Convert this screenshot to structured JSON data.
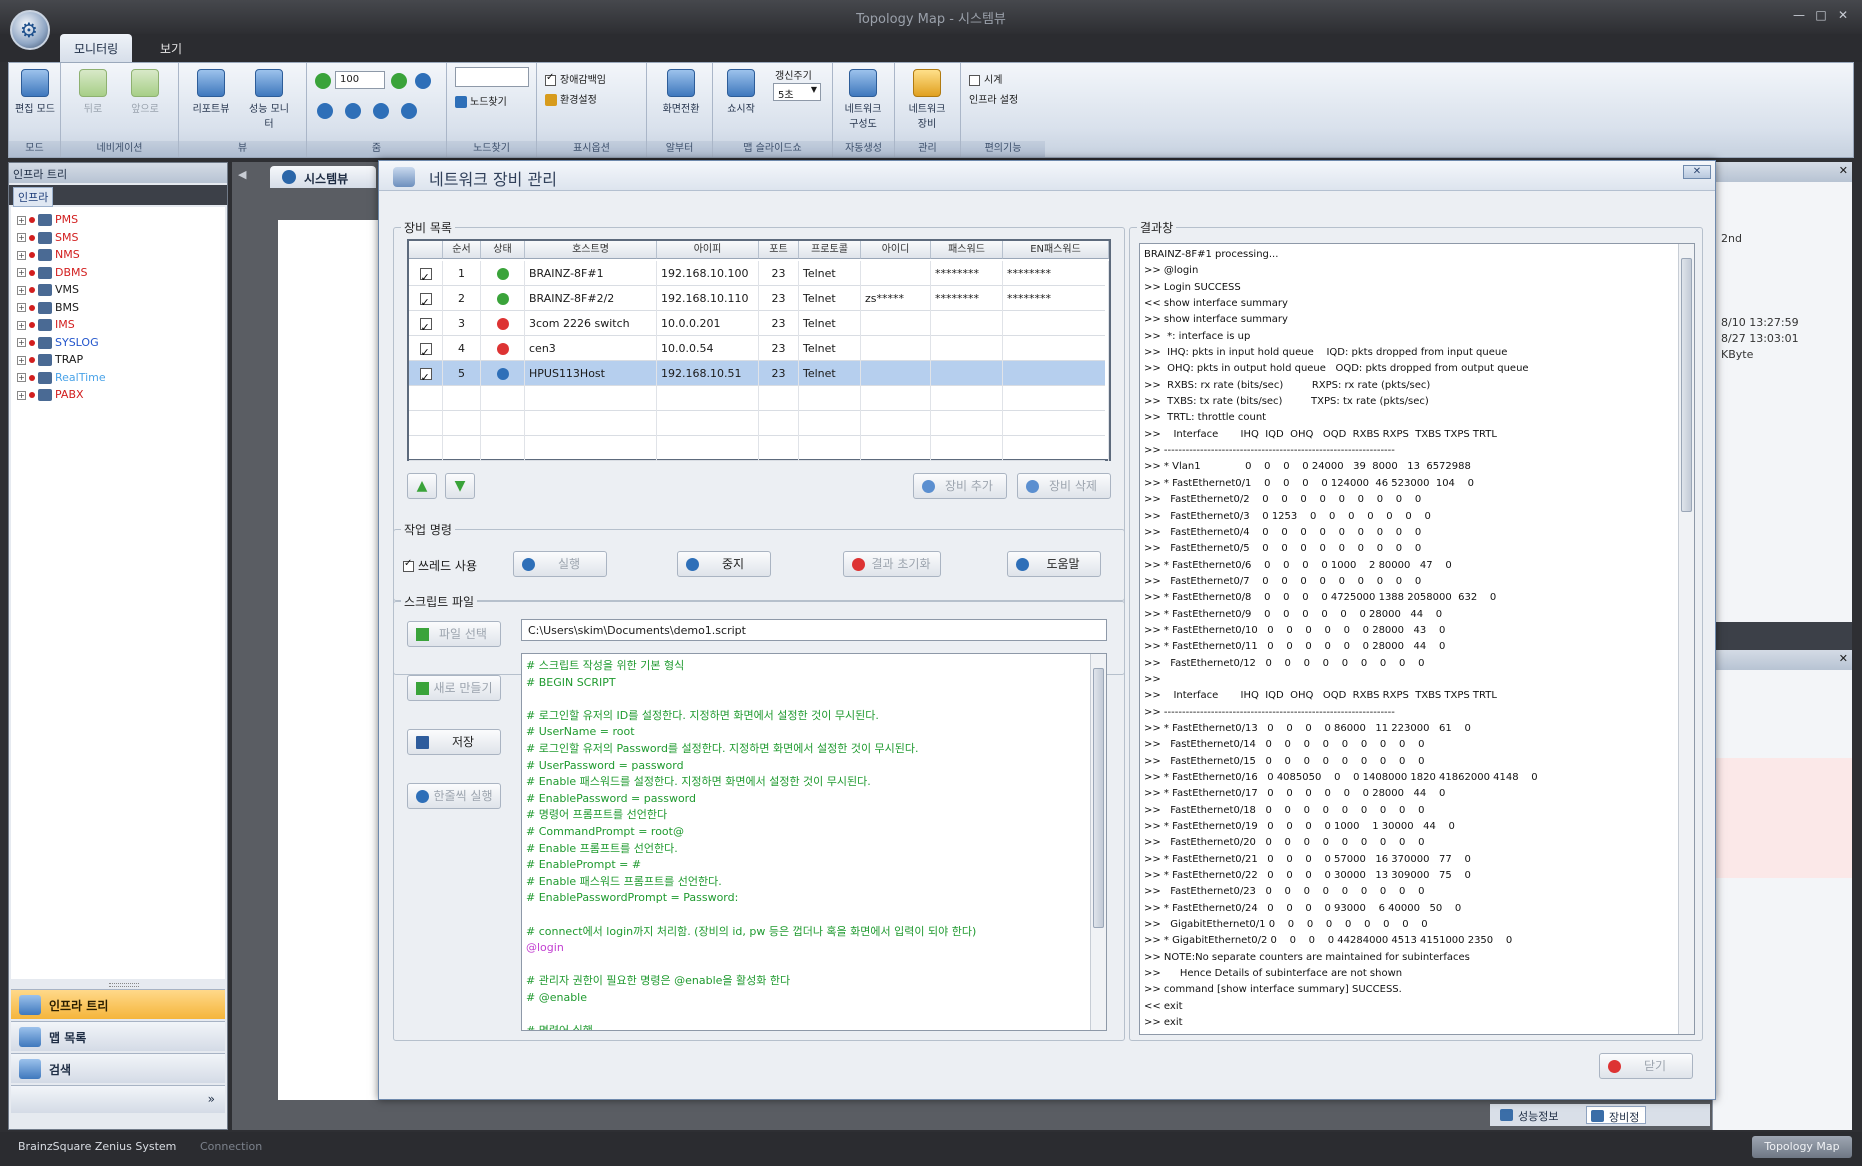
{
  "window": {
    "title": "Topology Map - 시스템뷰"
  },
  "ribbon": {
    "tabs": [
      "모니터링",
      "보기"
    ],
    "groups": [
      {
        "label": "모드",
        "buttons": [
          "편집 모드"
        ]
      },
      {
        "label": "네비게이션",
        "buttons": [
          "뒤로",
          "앞으로"
        ]
      },
      {
        "label": "뷰",
        "buttons": [
          "리포트뷰",
          "성능 모니터"
        ]
      },
      {
        "label": "줌",
        "zoom_value": "100"
      },
      {
        "label": "노드찾기",
        "buttons": [
          "노드찾기"
        ]
      },
      {
        "label": "표시옵션",
        "checkbox": "장애감백임",
        "button": "환경설정"
      },
      {
        "label": "알부터",
        "buttons": [
          "화면전환"
        ]
      },
      {
        "label": "맵 슬라이드쇼",
        "buttons": [
          "쇼시작"
        ],
        "cycle_label": "갱신주기",
        "cycle_value": "5초"
      },
      {
        "label": "자동생성",
        "buttons": [
          "네트워크 구성도"
        ]
      },
      {
        "label": "관리",
        "buttons": [
          "네트워크 장비"
        ]
      },
      {
        "label": "편의기능",
        "checkbox": "시계",
        "button": "인프라 설정"
      }
    ]
  },
  "left_panel": {
    "title": "인프라 트리",
    "root": "인프라",
    "tree": [
      {
        "label": "PMS",
        "color": "#d21e1e"
      },
      {
        "label": "SMS",
        "color": "#d21e1e"
      },
      {
        "label": "NMS",
        "color": "#d21e1e"
      },
      {
        "label": "DBMS",
        "color": "#d21e1e"
      },
      {
        "label": "VMS",
        "color": "#1a1a1a"
      },
      {
        "label": "BMS",
        "color": "#1a1a1a"
      },
      {
        "label": "IMS",
        "color": "#d21e1e"
      },
      {
        "label": "SYSLOG",
        "color": "#2255cc"
      },
      {
        "label": "TRAP",
        "color": "#1a1a1a"
      },
      {
        "label": "RealTime",
        "color": "#4aa3e8"
      },
      {
        "label": "PABX",
        "color": "#d21e1e"
      }
    ],
    "nav": [
      "인프라 트리",
      "맵 목록",
      "검색"
    ]
  },
  "doc_tab": "시스템뷰",
  "dialog": {
    "title": "네트워크 장비 관리",
    "device_list": {
      "label": "장비 목록",
      "headers": [
        "순서",
        "상태",
        "호스트명",
        "아이피",
        "포트",
        "프로토콜",
        "아이디",
        "패스워드",
        "EN패스워드"
      ],
      "rows": [
        {
          "order": "1",
          "status": "ok",
          "host": "BRAINZ-8F#1",
          "ip": "192.168.10.100",
          "port": "23",
          "protocol": "Telnet",
          "id": "",
          "password": "********",
          "en_password": "********"
        },
        {
          "order": "2",
          "status": "ok",
          "host": "BRAINZ-8F#2/2",
          "ip": "192.168.10.110",
          "port": "23",
          "protocol": "Telnet",
          "id": "zs*****",
          "password": "********",
          "en_password": "********"
        },
        {
          "order": "3",
          "status": "err",
          "host": "3com 2226 switch",
          "ip": "10.0.0.201",
          "port": "23",
          "protocol": "Telnet",
          "id": "",
          "password": "",
          "en_password": ""
        },
        {
          "order": "4",
          "status": "err",
          "host": "cen3",
          "ip": "10.0.0.54",
          "port": "23",
          "protocol": "Telnet",
          "id": "",
          "password": "",
          "en_password": ""
        },
        {
          "order": "5",
          "status": "host",
          "host": "HPUS113Host",
          "ip": "192.168.10.51",
          "port": "23",
          "protocol": "Telnet",
          "id": "",
          "password": "",
          "en_password": ""
        }
      ],
      "add_button": "장비 추가",
      "delete_button": "장비 삭제"
    },
    "job": {
      "label": "작업 명령",
      "thread_checkbox": "쓰레드 사용",
      "run_button": "실행",
      "stop_button": "중지",
      "clear_button": "결과 초기화",
      "help_button": "도움말"
    },
    "script": {
      "label": "스크립트 파일",
      "select_button": "파일 선택",
      "new_button": "새로 만들기",
      "save_button": "저장",
      "run_once_button": "한줄씩 실행",
      "path": "C:\\Users\\skim\\Documents\\demo1.script",
      "lines": [
        {
          "t": "# 스크립트 작성을 위한 기본 형식",
          "c": "#1f9a2f"
        },
        {
          "t": "# BEGIN SCRIPT",
          "c": "#1f9a2f"
        },
        {
          "t": "",
          "c": "#1f9a2f"
        },
        {
          "t": "# 로그인할 유저의 ID를 설정한다. 지정하면 화면에서 설정한 것이 무시된다.",
          "c": "#1f9a2f"
        },
        {
          "t": "# UserName = root",
          "c": "#1f9a2f"
        },
        {
          "t": "# 로그인할 유저의 Password를 설정한다. 지정하면 화면에서 설정한 것이 무시된다.",
          "c": "#1f9a2f"
        },
        {
          "t": "# UserPassword = password",
          "c": "#1f9a2f"
        },
        {
          "t": "# Enable 패스워드를 설정한다. 지정하면 화면에서 설정한 것이 무시된다.",
          "c": "#1f9a2f"
        },
        {
          "t": "# EnablePassword = password",
          "c": "#1f9a2f"
        },
        {
          "t": "# 명령어 프롬프트를 선언한다",
          "c": "#1f9a2f"
        },
        {
          "t": "# CommandPrompt = root@",
          "c": "#1f9a2f"
        },
        {
          "t": "# Enable 프롬프트를 선언한다.",
          "c": "#1f9a2f"
        },
        {
          "t": "# EnablePrompt = #",
          "c": "#1f9a2f"
        },
        {
          "t": "# Enable 패스워드 프롬프트를 선언한다.",
          "c": "#1f9a2f"
        },
        {
          "t": "# EnablePasswordPrompt = Password:",
          "c": "#1f9a2f"
        },
        {
          "t": "",
          "c": "#1f9a2f"
        },
        {
          "t": "# connect에서 login까지 처리함. (장비의 id, pw 등은 껍더나 혹을 화면에서 입력이 되야 한다)",
          "c": "#1f9a2f"
        },
        {
          "t": "@login",
          "c": "#c23fd1"
        },
        {
          "t": "",
          "c": "#1f9a2f"
        },
        {
          "t": "# 관리자 권한이 필요한 명령은 @enable을 활성화 한다",
          "c": "#1f9a2f"
        },
        {
          "t": "# @enable",
          "c": "#1f9a2f"
        },
        {
          "t": "",
          "c": "#1f9a2f"
        },
        {
          "t": "# 명령어 실행",
          "c": "#1f9a2f"
        }
      ]
    },
    "result": {
      "label": "결과창",
      "lines": [
        "BRAINZ-8F#1 processing...",
        ">> @login",
        ">> Login SUCCESS",
        "<< show interface summary",
        ">> show interface summary",
        ">>  *: interface is up",
        ">>  IHQ: pkts in input hold queue    IQD: pkts dropped from input queue",
        ">>  OHQ: pkts in output hold queue   OQD: pkts dropped from output queue",
        ">>  RXBS: rx rate (bits/sec)         RXPS: rx rate (pkts/sec)",
        ">>  TXBS: tx rate (bits/sec)         TXPS: tx rate (pkts/sec)",
        ">>  TRTL: throttle count",
        ">>    Interface       IHQ  IQD  OHQ   OQD  RXBS RXPS  TXBS TXPS TRTL",
        ">> ----------------------------------------------------------------",
        ">> * Vlan1              0    0    0    0 24000   39  8000   13  6572988",
        ">> * FastEthernet0/1    0    0    0    0 124000  46 523000  104    0",
        ">>   FastEthernet0/2    0    0    0    0    0    0    0    0    0",
        ">>   FastEthernet0/3    0 1253    0    0    0    0    0    0    0",
        ">>   FastEthernet0/4    0    0    0    0    0    0    0    0    0",
        ">>   FastEthernet0/5    0    0    0    0    0    0    0    0    0",
        ">> * FastEthernet0/6    0    0    0    0 1000    2 80000   47    0",
        ">>   FastEthernet0/7    0    0    0    0    0    0    0    0    0",
        ">> * FastEthernet0/8    0    0    0    0 4725000 1388 2058000  632    0",
        ">> * FastEthernet0/9    0    0    0    0    0    0 28000   44    0",
        ">> * FastEthernet0/10   0    0    0    0    0    0 28000   43    0",
        ">> * FastEthernet0/11   0    0    0    0    0    0 28000   44    0",
        ">>   FastEthernet0/12   0    0    0    0    0    0    0    0    0",
        ">>",
        ">>    Interface       IHQ  IQD  OHQ   OQD  RXBS RXPS  TXBS TXPS TRTL",
        ">> ----------------------------------------------------------------",
        ">> * FastEthernet0/13   0    0    0    0 86000   11 223000   61    0",
        ">>   FastEthernet0/14   0    0    0    0    0    0    0    0    0",
        ">>   FastEthernet0/15   0    0    0    0    0    0    0    0    0",
        ">> * FastEthernet0/16   0 4085050    0    0 1408000 1820 41862000 4148    0",
        ">> * FastEthernet0/17   0    0    0    0    0    0 28000   44    0",
        ">>   FastEthernet0/18   0    0    0    0    0    0    0    0    0",
        ">> * FastEthernet0/19   0    0    0    0 1000    1 30000   44    0",
        ">>   FastEthernet0/20   0    0    0    0    0    0    0    0    0",
        ">> * FastEthernet0/21   0    0    0    0 57000   16 370000   77    0",
        ">> * FastEthernet0/22   0    0    0    0 30000   13 309000   75    0",
        ">>   FastEthernet0/23   0    0    0    0    0    0    0    0    0",
        ">> * FastEthernet0/24   0    0    0    0 93000    6 40000   50    0",
        ">>   GigabitEthernet0/1 0    0    0    0    0    0    0    0    0",
        ">> * GigabitEthernet0/2 0    0    0    0 44284000 4513 4151000 2350    0",
        ">> NOTE:No separate counters are maintained for subinterfaces",
        ">>      Hence Details of subinterface are not shown",
        ">> command [show interface summary] SUCCESS.",
        "<< exit",
        ">> exit",
        ">> ------------------------------------"
      ]
    },
    "close_button": "닫기"
  },
  "right_panel": {
    "lines": [
      "2nd",
      "8/10 13:27:59",
      "8/27 13:03:01",
      "KByte"
    ]
  },
  "bottom_tabs": [
    "성능정보",
    "장비정"
  ],
  "status": {
    "left": "BrainzSquare Zenius System",
    "connection": "Connection",
    "right": "Topology Map"
  }
}
